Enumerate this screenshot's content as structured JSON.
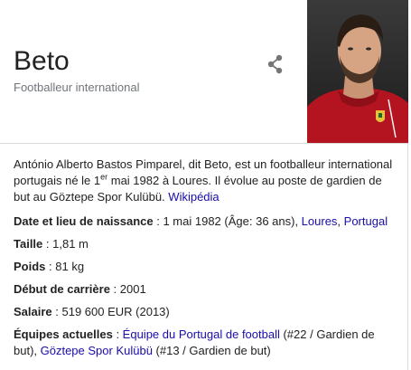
{
  "entity": {
    "name": "Beto",
    "subtitle": "Footballeur international"
  },
  "description": {
    "part1": "António Alberto Bastos Pimparel, dit Beto, est un footballeur international portugais né le 1",
    "sup": "er",
    "part2": " mai 1982 à Loures. Il évolue au poste de gardien de but au Göztepe Spor Kulübü. ",
    "source_link": "Wikipédia"
  },
  "facts": {
    "birth": {
      "label": "Date et lieu de naissance",
      "sep": " : ",
      "value": "1 mai 1982 (Âge: 36 ans), ",
      "link1": "Loures",
      "comma": ", ",
      "link2": "Portugal"
    },
    "height": {
      "label": "Taille",
      "sep": " : ",
      "value": "1,81 m"
    },
    "weight": {
      "label": "Poids",
      "sep": " : ",
      "value": "81 kg"
    },
    "career_start": {
      "label": "Début de carrière",
      "sep": " : ",
      "value": "2001"
    },
    "salary": {
      "label": "Salaire",
      "sep": " : ",
      "value": "519 600 EUR (2013)"
    },
    "teams": {
      "label": "Équipes actuelles",
      "sep": " : ",
      "team1": "Équipe du Portugal de football",
      "team1_note": " (#22 / Gardien de but), ",
      "team2": "Göztepe Spor Kulübü",
      "team2_note": " (#13 / Gardien de but)"
    }
  },
  "icons": {
    "share": "share-icon"
  },
  "colors": {
    "link": "#1a0dab",
    "subtitle": "#70757a",
    "jersey": "#b3141f"
  }
}
